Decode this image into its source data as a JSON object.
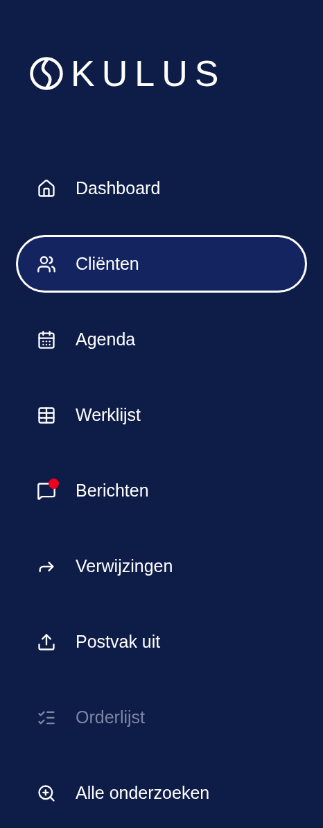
{
  "logo": {
    "text": "KULUS"
  },
  "nav": [
    {
      "label": "Dashboard",
      "selected": false,
      "disabled": false,
      "notification": false
    },
    {
      "label": "Cliënten",
      "selected": true,
      "disabled": false,
      "notification": false
    },
    {
      "label": "Agenda",
      "selected": false,
      "disabled": false,
      "notification": false
    },
    {
      "label": "Werklijst",
      "selected": false,
      "disabled": false,
      "notification": false
    },
    {
      "label": "Berichten",
      "selected": false,
      "disabled": false,
      "notification": true
    },
    {
      "label": "Verwijzingen",
      "selected": false,
      "disabled": false,
      "notification": false
    },
    {
      "label": "Postvak uit",
      "selected": false,
      "disabled": false,
      "notification": false
    },
    {
      "label": "Orderlijst",
      "selected": false,
      "disabled": true,
      "notification": false
    },
    {
      "label": "Alle onderzoeken",
      "selected": false,
      "disabled": false,
      "notification": false
    }
  ]
}
